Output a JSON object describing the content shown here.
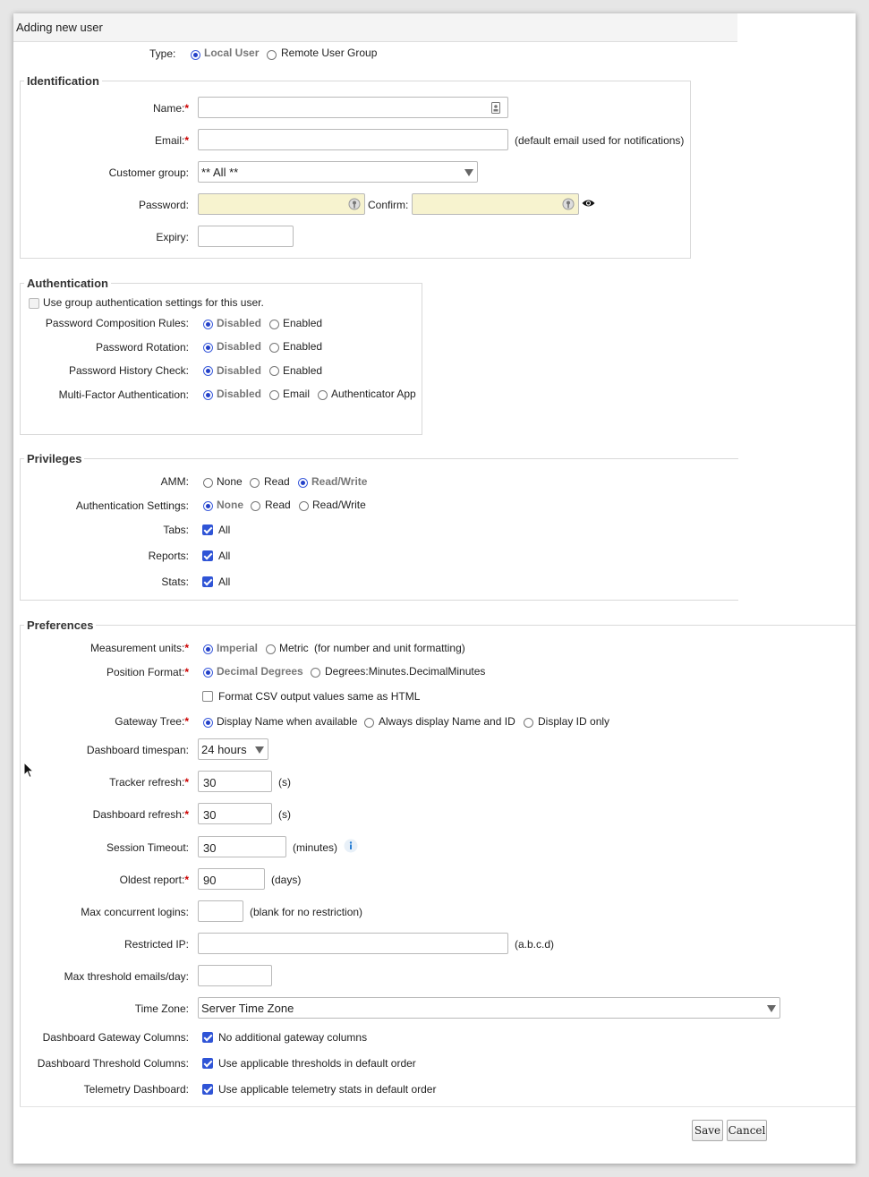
{
  "dialog": {
    "title": "Adding new user"
  },
  "type_row": {
    "label": "Type:",
    "options": [
      "Local User",
      "Remote User Group"
    ],
    "selected": "Local User"
  },
  "identification": {
    "legend": "Identification",
    "name_label": "Name:",
    "email_label": "Email:",
    "email_hint": "(default email used for notifications)",
    "customer_group_label": "Customer group:",
    "customer_group_value": "** All **",
    "password_label": "Password:",
    "confirm_label": "Confirm:",
    "expiry_label": "Expiry:"
  },
  "authentication": {
    "legend": "Authentication",
    "use_group_label": "Use group authentication settings for this user.",
    "rows": [
      {
        "label": "Password Composition Rules:",
        "options": [
          "Disabled",
          "Enabled"
        ],
        "selected": "Disabled"
      },
      {
        "label": "Password Rotation:",
        "options": [
          "Disabled",
          "Enabled"
        ],
        "selected": "Disabled"
      },
      {
        "label": "Password History Check:",
        "options": [
          "Disabled",
          "Enabled"
        ],
        "selected": "Disabled"
      },
      {
        "label": "Multi-Factor Authentication:",
        "options": [
          "Disabled",
          "Email",
          "Authenticator App"
        ],
        "selected": "Disabled"
      }
    ]
  },
  "privileges": {
    "legend": "Privileges",
    "amm": {
      "label": "AMM:",
      "options": [
        "None",
        "Read",
        "Read/Write"
      ],
      "selected": "Read/Write"
    },
    "auth_settings": {
      "label": "Authentication Settings:",
      "options": [
        "None",
        "Read",
        "Read/Write"
      ],
      "selected": "None"
    },
    "tabs": {
      "label": "Tabs:",
      "check_label": "All",
      "checked": true
    },
    "reports": {
      "label": "Reports:",
      "check_label": "All",
      "checked": true
    },
    "stats": {
      "label": "Stats:",
      "check_label": "All",
      "checked": true
    }
  },
  "preferences": {
    "legend": "Preferences",
    "measurement": {
      "label": "Measurement units:",
      "options": [
        "Imperial",
        "Metric"
      ],
      "selected": "Imperial",
      "hint": "(for number and unit formatting)"
    },
    "position": {
      "label": "Position Format:",
      "options": [
        "Decimal Degrees",
        "Degrees:Minutes.DecimalMinutes"
      ],
      "selected": "Decimal Degrees"
    },
    "csv_label": "Format CSV output values same as HTML",
    "csv_checked": false,
    "gateway_tree": {
      "label": "Gateway Tree:",
      "options": [
        "Display Name when available",
        "Always display Name and ID",
        "Display ID only"
      ],
      "selected": "Display Name when available"
    },
    "dashboard_timespan": {
      "label": "Dashboard timespan:",
      "value": "24 hours"
    },
    "tracker_refresh": {
      "label": "Tracker refresh:",
      "value": "30",
      "unit": "(s)"
    },
    "dashboard_refresh": {
      "label": "Dashboard refresh:",
      "value": "30",
      "unit": "(s)"
    },
    "session_timeout": {
      "label": "Session Timeout:",
      "value": "30",
      "unit": "(minutes)"
    },
    "oldest_report": {
      "label": "Oldest report:",
      "value": "90",
      "unit": "(days)"
    },
    "max_logins": {
      "label": "Max concurrent logins:",
      "value": "",
      "hint": "(blank for no restriction)"
    },
    "restricted_ip": {
      "label": "Restricted IP:",
      "value": "",
      "hint": "(a.b.c.d)"
    },
    "max_threshold": {
      "label": "Max threshold emails/day:",
      "value": ""
    },
    "time_zone": {
      "label": "Time Zone:",
      "value": "Server Time Zone"
    },
    "gateway_columns": {
      "label": "Dashboard Gateway Columns:",
      "check_label": "No additional gateway columns",
      "checked": true
    },
    "threshold_columns": {
      "label": "Dashboard Threshold Columns:",
      "check_label": "Use applicable thresholds in default order",
      "checked": true
    },
    "telemetry_dashboard": {
      "label": "Telemetry Dashboard:",
      "check_label": "Use applicable telemetry stats in default order",
      "checked": true
    }
  },
  "buttons": {
    "save": "Save",
    "cancel": "Cancel"
  },
  "colors": {
    "accent": "#2f54d6",
    "required": "#cc0000",
    "password_bg": "#f7f3cf",
    "dialog_bg": "#ffffff",
    "page_bg": "#e6e6e6"
  },
  "icons": [
    "contact-card-icon",
    "key-hint-icon",
    "eye-icon",
    "info-icon",
    "dropdown-arrow-icon",
    "mouse-cursor-icon"
  ]
}
